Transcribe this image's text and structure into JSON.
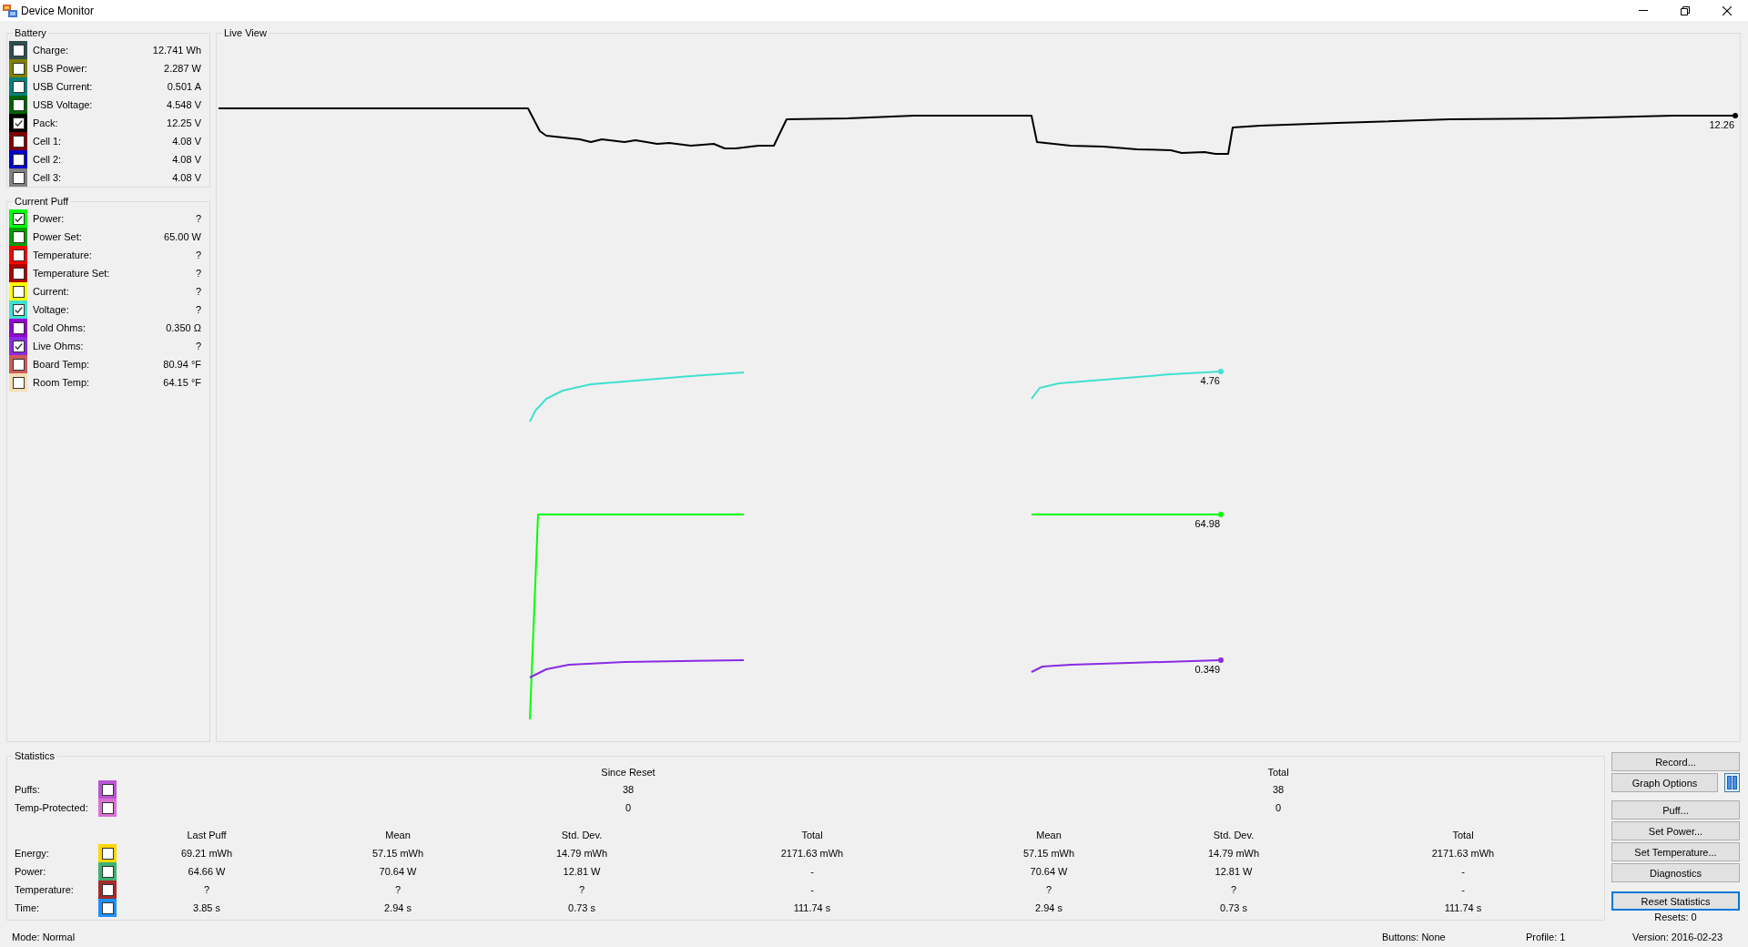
{
  "window": {
    "title": "Device Monitor"
  },
  "battery": {
    "title": "Battery",
    "items": [
      {
        "label": "Charge:",
        "value": "12.741 Wh",
        "color": "#2f4f4f",
        "checked": false
      },
      {
        "label": "USB Power:",
        "value": "2.287 W",
        "color": "#808000",
        "checked": false
      },
      {
        "label": "USB Current:",
        "value": "0.501 A",
        "color": "#008080",
        "checked": false
      },
      {
        "label": "USB Voltage:",
        "value": "4.548 V",
        "color": "#006400",
        "checked": false
      },
      {
        "label": "Pack:",
        "value": "12.25 V",
        "color": "#000000",
        "checked": true
      },
      {
        "label": "Cell 1:",
        "value": "4.08 V",
        "color": "#800000",
        "checked": false
      },
      {
        "label": "Cell 2:",
        "value": "4.08 V",
        "color": "#0000cd",
        "checked": false
      },
      {
        "label": "Cell 3:",
        "value": "4.08 V",
        "color": "#808080",
        "checked": false
      }
    ]
  },
  "current_puff": {
    "title": "Current Puff",
    "items": [
      {
        "label": "Power:",
        "value": "?",
        "color": "#00ff00",
        "checked": true
      },
      {
        "label": "Power Set:",
        "value": "65.00 W",
        "color": "#00a000",
        "checked": false
      },
      {
        "label": "Temperature:",
        "value": "?",
        "color": "#ff0000",
        "checked": false
      },
      {
        "label": "Temperature Set:",
        "value": "?",
        "color": "#b00000",
        "checked": false
      },
      {
        "label": "Current:",
        "value": "?",
        "color": "#ffff00",
        "checked": false
      },
      {
        "label": "Voltage:",
        "value": "?",
        "color": "#40e0d0",
        "checked": true
      },
      {
        "label": "Cold Ohms:",
        "value": "0.350 Ω",
        "color": "#9400d3",
        "checked": false
      },
      {
        "label": "Live Ohms:",
        "value": "?",
        "color": "#8a2be2",
        "checked": true
      },
      {
        "label": "Board Temp:",
        "value": "80.94 °F",
        "color": "#cd5c5c",
        "checked": false
      },
      {
        "label": "Room Temp:",
        "value": "64.15 °F",
        "color": "#f5deb3",
        "checked": false
      }
    ]
  },
  "live_view": {
    "title": "Live View",
    "traces": [
      {
        "color": "#000000",
        "end_label": "12.26"
      },
      {
        "color": "#40e0d0",
        "end_label": "4.76"
      },
      {
        "color": "#00ff00",
        "end_label": "64.98"
      },
      {
        "color": "#8a2be2",
        "end_label": "0.349"
      }
    ]
  },
  "statistics": {
    "title": "Statistics",
    "groups": [
      {
        "title": "Since Reset"
      },
      {
        "title": "Total"
      }
    ],
    "counters": [
      {
        "label": "Puffs:",
        "color": "#ba55d3",
        "checked": false,
        "values": [
          "38",
          "38"
        ]
      },
      {
        "label": "Temp-Protected:",
        "color": "#da70d6",
        "checked": false,
        "values": [
          "0",
          "0"
        ]
      }
    ],
    "columns": [
      "Last Puff",
      "Mean",
      "Std. Dev.",
      "Total",
      "Mean",
      "Std. Dev.",
      "Total"
    ],
    "rows": [
      {
        "label": "Energy:",
        "color": "#ffd700",
        "checked": false,
        "values": [
          "69.21 mWh",
          "57.15 mWh",
          "14.79 mWh",
          "2171.63 mWh",
          "57.15 mWh",
          "14.79 mWh",
          "2171.63 mWh"
        ]
      },
      {
        "label": "Power:",
        "color": "#3cb371",
        "checked": false,
        "values": [
          "64.66 W",
          "70.64 W",
          "12.81 W",
          "-",
          "70.64 W",
          "12.81 W",
          "-"
        ]
      },
      {
        "label": "Temperature:",
        "color": "#a52a2a",
        "checked": false,
        "values": [
          "?",
          "?",
          "?",
          "-",
          "?",
          "?",
          "-"
        ]
      },
      {
        "label": "Time:",
        "color": "#1e90ff",
        "checked": false,
        "values": [
          "3.85 s",
          "2.94 s",
          "0.73 s",
          "111.74 s",
          "2.94 s",
          "0.73 s",
          "111.74 s"
        ]
      }
    ]
  },
  "side_buttons": [
    {
      "rows": [
        [
          {
            "kind": "button",
            "label": "Record...",
            "focused": false
          }
        ],
        [
          {
            "kind": "button",
            "label": "Graph Options",
            "focused": false
          },
          {
            "kind": "pause",
            "focused": false
          }
        ]
      ]
    },
    {
      "rows": [
        [
          {
            "kind": "button",
            "label": "Puff...",
            "focused": false
          }
        ],
        [
          {
            "kind": "button",
            "label": "Set Power...",
            "focused": false
          }
        ],
        [
          {
            "kind": "button",
            "label": "Set Temperature...",
            "focused": false
          }
        ],
        [
          {
            "kind": "button",
            "label": "Diagnostics",
            "focused": false
          }
        ]
      ]
    },
    {
      "rows": [
        [
          {
            "kind": "button",
            "label": "Reset Statistics",
            "focused": true
          }
        ]
      ]
    }
  ],
  "resets": "Resets: 0",
  "status_bar": [
    "Mode: Normal",
    "Buttons: None",
    "Profile: 1",
    "Version: 2016-02-23"
  ]
}
